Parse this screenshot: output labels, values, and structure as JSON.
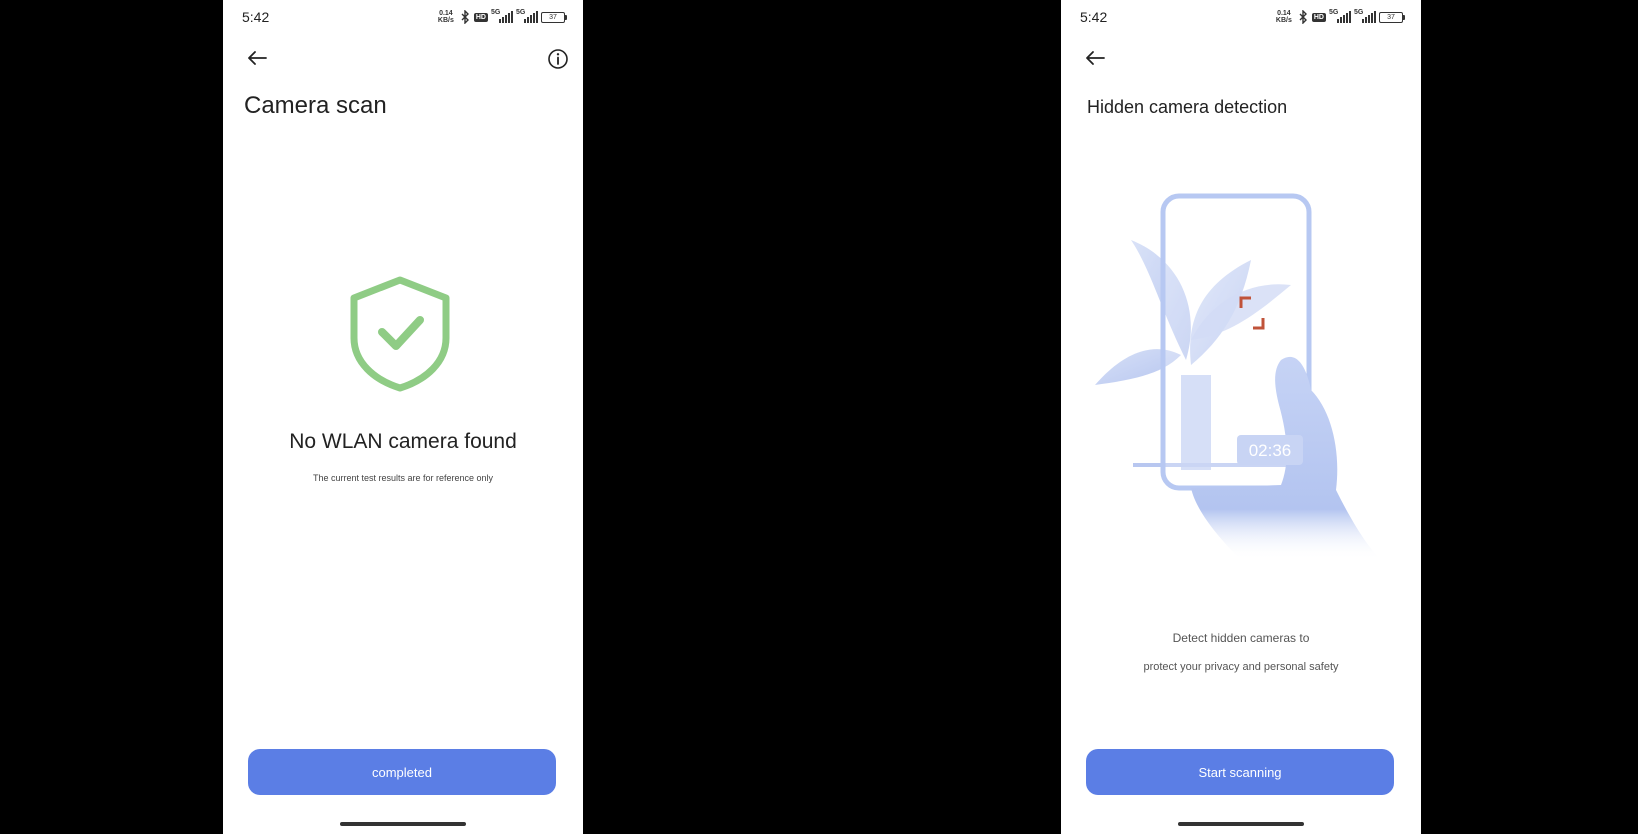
{
  "status_bar": {
    "time": "5:42",
    "net_speed_value": "0.14",
    "net_speed_unit": "KB/s",
    "hd_label": "HD",
    "signal_1_label": "5G",
    "signal_2_label": "5G",
    "battery": "37"
  },
  "left_screen": {
    "title": "Camera scan",
    "result_title": "No WLAN camera found",
    "result_subtitle": "The current test results are for reference only",
    "button_label": "completed",
    "icons": [
      "back-arrow-icon",
      "info-icon",
      "shield-check-icon"
    ],
    "colors": {
      "shield": "#8fcc85",
      "button": "#5b7ee5"
    }
  },
  "right_screen": {
    "title": "Hidden camera detection",
    "illustration_timer": "02:36",
    "description_line1": "Detect hidden cameras to",
    "description_line2": "protect your privacy and personal safety",
    "button_label": "Start scanning",
    "icons": [
      "back-arrow-icon"
    ],
    "colors": {
      "illustration": "#b7c8f2",
      "focus_frame": "#c0533a",
      "button": "#5b7ee5"
    }
  }
}
